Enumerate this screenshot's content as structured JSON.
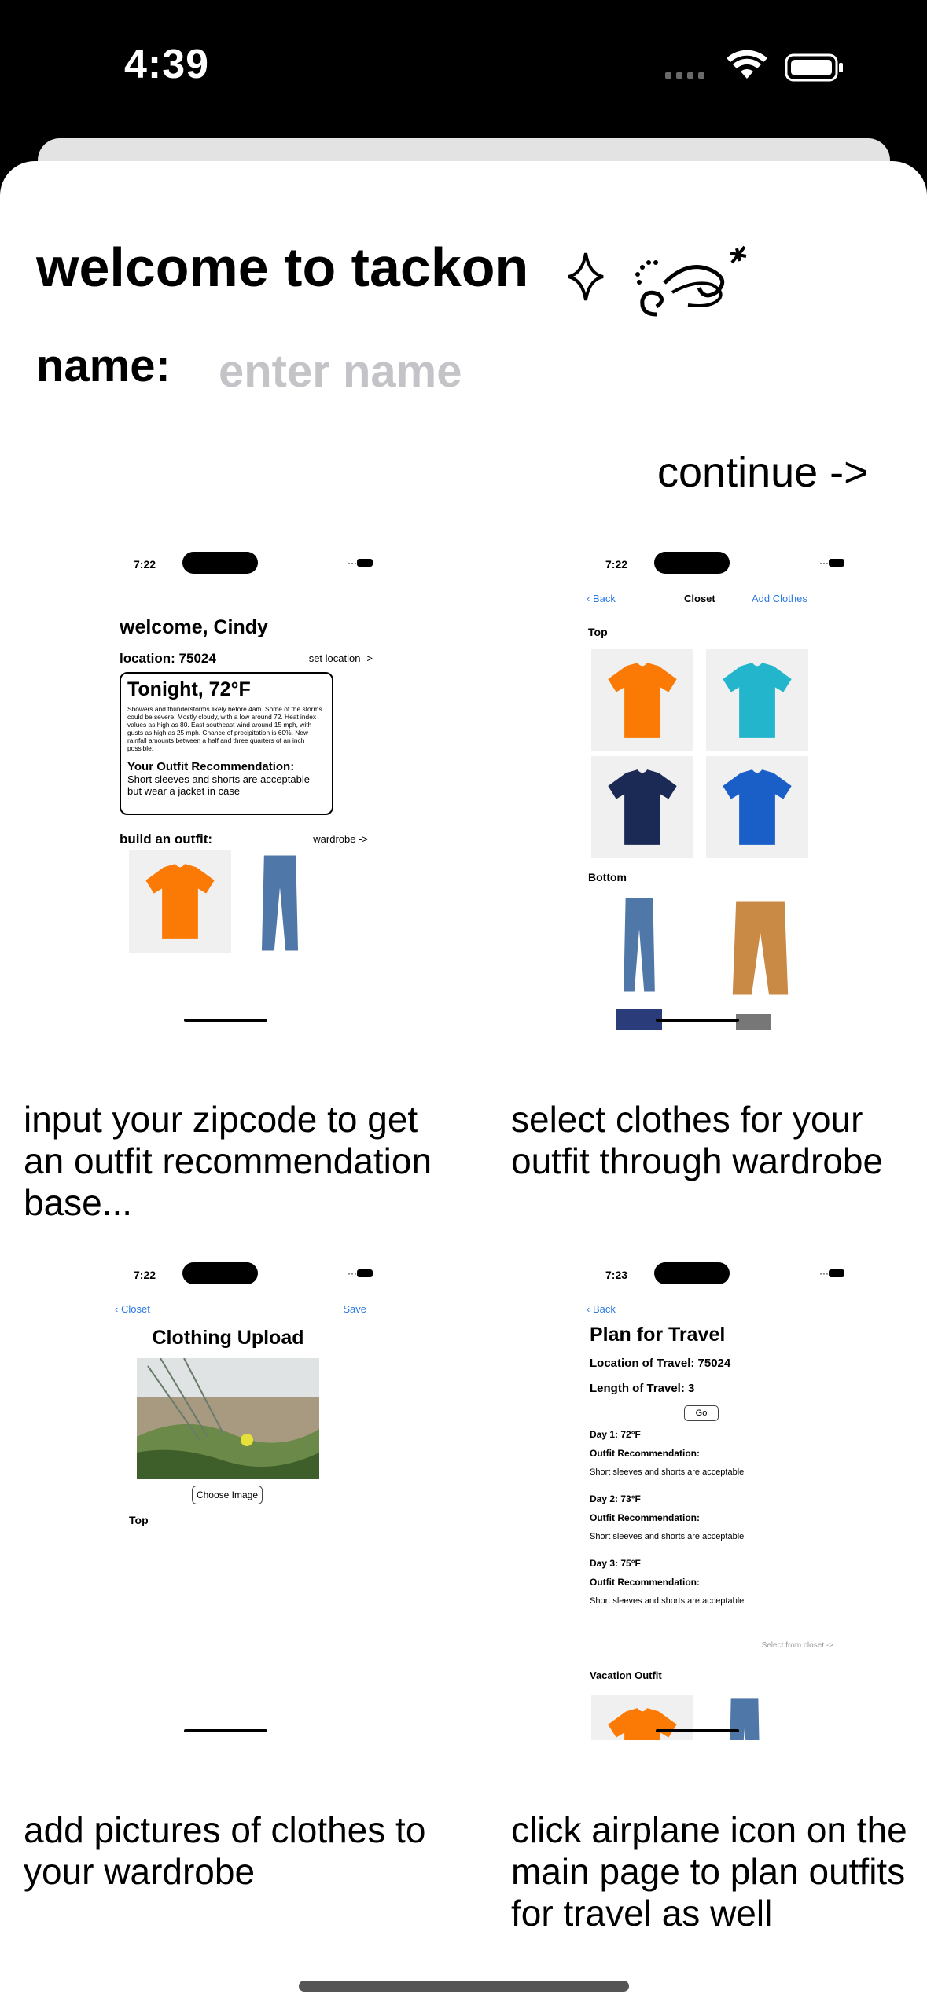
{
  "status": {
    "time": "4:39"
  },
  "welcome": {
    "title": "welcome to tackon",
    "name_label": "name:",
    "name_placeholder": "enter name",
    "continue_label": "continue ->"
  },
  "colors": {
    "orange": "#fb7a05",
    "teal": "#22b5cc",
    "navy": "#1b2a55",
    "blue": "#1a5fc8",
    "link": "#2b7ae4",
    "placeholder": "#c4c4c8"
  },
  "shots": {
    "home": {
      "time": "7:22",
      "greeting": "welcome, Cindy",
      "location": "location: 75024",
      "set_location": "set location ->",
      "weather_title": "Tonight, 72°F",
      "forecast": "Showers and thunderstorms likely before 4am. Some of the storms could be severe. Mostly cloudy, with a low around 72. Heat index values as high as 80. East southeast wind around 15 mph, with gusts as high as 25 mph. Chance of precipitation is 60%. New rainfall amounts between a half and three quarters of an inch possible.",
      "rec_title": "Your Outfit Recommendation:",
      "rec_text": "Short sleeves and shorts are acceptable but wear a jacket in case",
      "build": "build an outfit:",
      "wardrobe": "wardrobe ->"
    },
    "closet": {
      "time": "7:22",
      "back": "Back",
      "title": "Closet",
      "add": "Add Clothes",
      "top": "Top",
      "bottom": "Bottom"
    },
    "upload": {
      "time": "7:22",
      "back": "Closet",
      "save": "Save",
      "title": "Clothing Upload",
      "choose": "Choose Image",
      "category": "Top"
    },
    "travel": {
      "time": "7:23",
      "back": "Back",
      "title": "Plan for Travel",
      "location": "Location of Travel: 75024",
      "length": "Length of Travel: 3",
      "go": "Go",
      "days": [
        {
          "day": "Day 1:   72°F",
          "rec": "Outfit Recommendation:",
          "text": "Short sleeves and shorts are acceptable"
        },
        {
          "day": "Day 2:   73°F",
          "rec": "Outfit Recommendation:",
          "text": "Short sleeves and shorts are acceptable"
        },
        {
          "day": "Day 3:   75°F",
          "rec": "Outfit Recommendation:",
          "text": "Short sleeves and shorts are acceptable"
        }
      ],
      "select": "Select from closet ->",
      "vacation": "Vacation Outfit"
    }
  },
  "captions": {
    "home": "input your zipcode to get an outfit recommendation base...",
    "closet": "select clothes for your outfit through wardrobe",
    "upload": "add pictures of clothes to your wardrobe",
    "travel": "click airplane icon on the main page to plan outfits for travel as well"
  }
}
